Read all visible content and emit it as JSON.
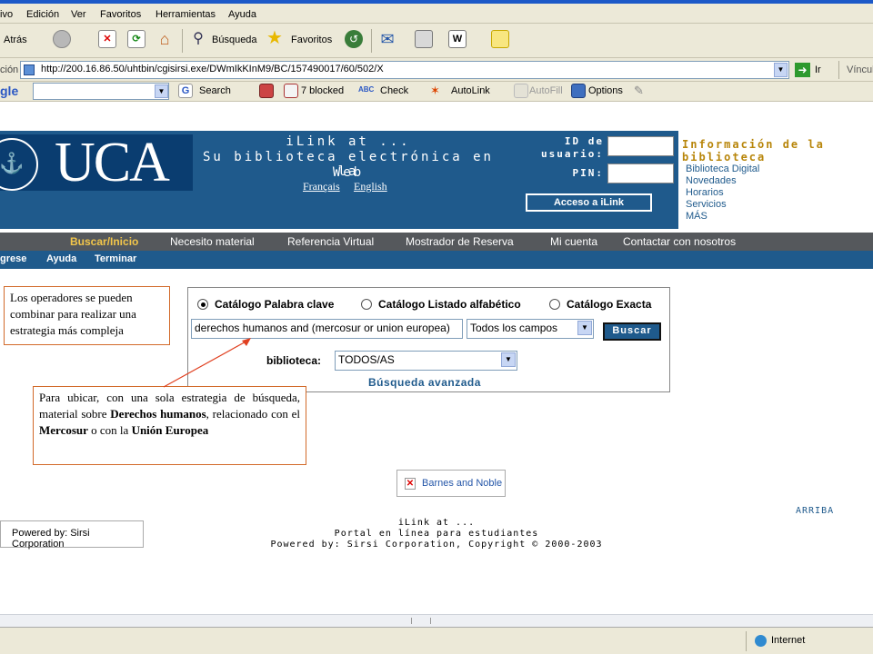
{
  "menu": [
    "ivo",
    "Edición",
    "Ver",
    "Favoritos",
    "Herramientas",
    "Ayuda"
  ],
  "toolbar": {
    "back": "Atrás",
    "search": "Búsqueda",
    "favorites": "Favoritos"
  },
  "address": {
    "label": "ción",
    "url": "http://200.16.86.50/uhtbin/cgisirsi.exe/DWmIkKInM9/BC/157490017/60/502/X",
    "go": "Ir",
    "links": "Víncul"
  },
  "google": {
    "brand": "gle",
    "search": "Search",
    "blocked": "7 blocked",
    "check": "Check",
    "autolink": "AutoLink",
    "autofill": "AutoFill",
    "options": "Options"
  },
  "banner": {
    "title1": "iLink at ...",
    "title2": "Su biblioteca electrónica en la",
    "title3": "Web",
    "lang1": "Français",
    "lang2": "English",
    "logo": "UCA",
    "id_label": "ID de usuario:",
    "pin_label": "PIN:",
    "access_button": "Acceso a iLink"
  },
  "info": {
    "title": "Información de la biblioteca",
    "links": [
      "Biblioteca Digital",
      "Novedades",
      "Horarios",
      "Servicios",
      "MÁS"
    ]
  },
  "nav": [
    "Buscar/Inicio",
    "Necesito material",
    "Referencia Virtual",
    "Mostrador de Reserva",
    "Mi cuenta",
    "Contactar con nosotros"
  ],
  "subnav": [
    "grese",
    "Ayuda",
    "Terminar"
  ],
  "search": {
    "radio1": "Catálogo Palabra clave",
    "radio2": "Catálogo Listado alfabético",
    "radio3": "Catálogo Exacta",
    "query": "derechos humanos and (mercosur or union europea)",
    "field": "Todos los campos",
    "button": "Buscar",
    "library_label": "biblioteca:",
    "library_value": "TODOS/AS",
    "advanced": "Búsqueda avanzada"
  },
  "note1": "Los operadores se pueden combinar para realizar una estrategia más compleja",
  "note2": {
    "p1": "Para ubicar, con una sola estrategia de búsqueda, material sobre ",
    "b1": "Derechos humanos",
    "p2": ", relacionado con el ",
    "b2": "Mercosur",
    "p3": " o con la ",
    "b3": "Unión Europea"
  },
  "barnes": "Barnes and Noble",
  "powered_img": "Powered by: Sirsi Corporation",
  "arriba": "ARRIBA",
  "footer": [
    "iLink at ...",
    "Portal en línea para estudiantes",
    "Powered by: Sirsi Corporation, Copyright © 2000-2003"
  ],
  "status": "Internet"
}
